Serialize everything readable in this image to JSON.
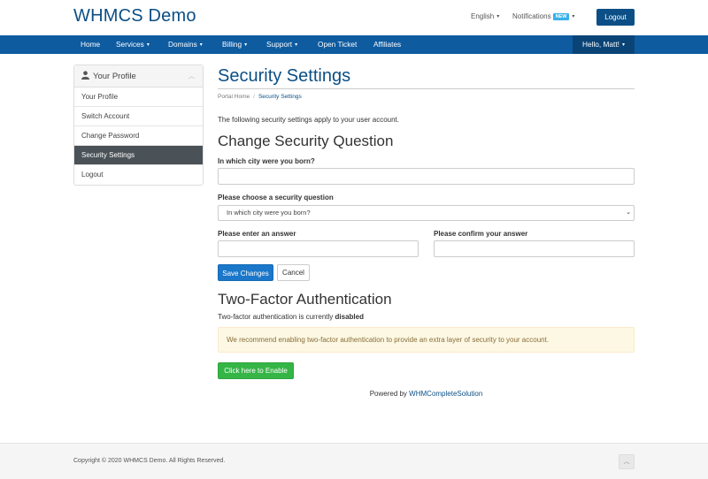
{
  "header": {
    "logo": "WHMCS Demo",
    "language": "English",
    "notifications": "Notifications",
    "notifications_badge": "NEW",
    "logout": "Logout"
  },
  "nav": {
    "items": [
      {
        "label": "Home"
      },
      {
        "label": "Services"
      },
      {
        "label": "Domains"
      },
      {
        "label": "Billing"
      },
      {
        "label": "Support"
      },
      {
        "label": "Open Ticket"
      },
      {
        "label": "Affiliates"
      }
    ],
    "user": "Hello, Matt!"
  },
  "sidebar": {
    "title": "Your Profile",
    "items": [
      {
        "label": "Your Profile"
      },
      {
        "label": "Switch Account"
      },
      {
        "label": "Change Password"
      },
      {
        "label": "Security Settings"
      },
      {
        "label": "Logout"
      }
    ]
  },
  "main": {
    "title": "Security Settings",
    "breadcrumb": [
      "Portal Home",
      "Security Settings"
    ],
    "intro": "The following security settings apply to your user account.",
    "question_section": {
      "heading": "Change Security Question",
      "current_question_label": "In which city were you born?",
      "current_answer_value": "",
      "choose_label": "Please choose a security question",
      "choose_selected": "In which city were you born?",
      "answer_label": "Please enter an answer",
      "answer_value": "",
      "confirm_label": "Please confirm your answer",
      "confirm_value": "",
      "save_button": "Save Changes",
      "cancel_button": "Cancel"
    },
    "twofa": {
      "heading": "Two-Factor Authentication",
      "status_prefix": "Two-factor authentication is currently",
      "status_value": "disabled",
      "alert": "We recommend enabling two-factor authentication to provide an extra layer of security to your account.",
      "enable_button": "Click here to Enable"
    },
    "powered_prefix": "Powered by",
    "powered_link": "WHMCompleteSolution"
  },
  "footer": {
    "copyright": "Copyright © 2020 WHMCS Demo. All Rights Reserved."
  },
  "colors": {
    "brand": "#0b4f86",
    "navbar": "#0e5ba0",
    "primary_button": "#1a77c9",
    "success_button": "#35b546",
    "sidebar_active": "#4a5258",
    "alert_bg": "#fcf8e3"
  }
}
